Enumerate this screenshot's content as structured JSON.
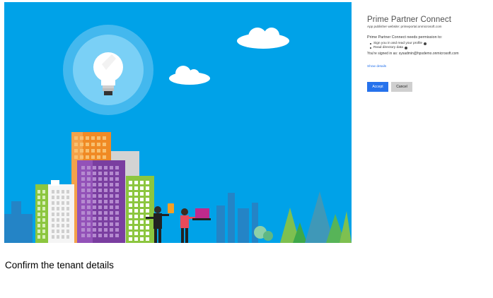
{
  "consent": {
    "app_name": "Prime Partner Connect",
    "publisher": "App publisher website: primeportal.onmicrosoft.com",
    "needs_permission": "Prime Partner Connect needs permission to:",
    "permissions": [
      "Sign you in and read your profile",
      "Read directory data"
    ],
    "signed_in_as": "You're signed in as: sysadmin@hpsdemo.onmicrosoft.com",
    "show_details": "Show details",
    "accept_label": "Accept",
    "cancel_label": "Cancel"
  },
  "caption": "Confirm the tenant details",
  "colors": {
    "sky": "#00a2e8",
    "accent": "#2672ec"
  }
}
